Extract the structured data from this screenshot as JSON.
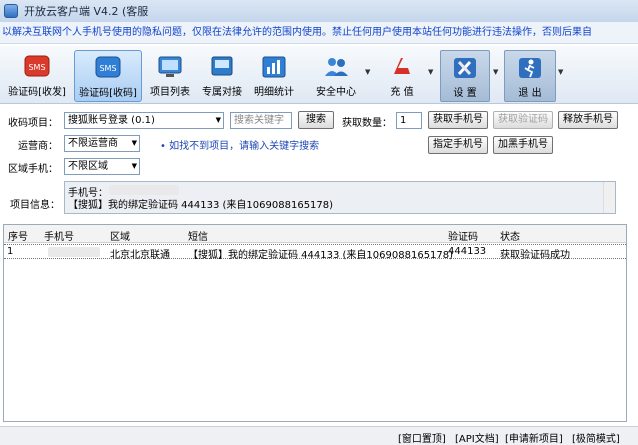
{
  "app": {
    "title": "开放云客户端 V4.2 (客服"
  },
  "notice": "以解决互联网个人手机号使用的隐私问题，仅限在法律允许的范围内使用。禁止任何用户使用本站任何功能进行违法操作，否则后果自",
  "toolbar": [
    {
      "label": "验证码[收发]",
      "icon": "sms-red-icon",
      "active": false
    },
    {
      "label": "验证码[收码]",
      "icon": "sms-blue-icon",
      "active": true
    },
    {
      "label": "项目列表",
      "icon": "project-list-icon",
      "active": false
    },
    {
      "label": "专属对接",
      "icon": "dedicated-icon",
      "active": false
    },
    {
      "label": "明细统计",
      "icon": "stats-chart-icon",
      "active": false
    },
    {
      "label": "安全中心",
      "icon": "security-users-icon",
      "active": false
    },
    {
      "label": "充 值",
      "icon": "recharge-pdf-icon",
      "active": false
    },
    {
      "label": "设 置",
      "icon": "settings-tools-icon",
      "active": false
    },
    {
      "label": "退 出",
      "icon": "exit-icon",
      "active": false
    }
  ],
  "form": {
    "project_label": "收码项目：",
    "project_value": "搜狐账号登录 (0.1)",
    "search_placeholder": "搜索关键字",
    "search_button": "搜索",
    "quantity_label": "获取数量：",
    "quantity_value": "1",
    "get_phone_button": "获取手机号",
    "get_code_button": "获取验证码",
    "release_button": "释放手机号",
    "operator_label": "运营商：",
    "operator_value": "不限运营商",
    "hint_link": "• 如找不到项目，请输入关键字搜索",
    "assign_button": "指定手机号",
    "blacklist_button": "加黑手机号",
    "region_label": "区域手机：",
    "region_value": "不限区域",
    "info_label": "项目信息：",
    "info_phone_label": "手机号：",
    "info_message": "【搜狐】我的绑定验证码 444133 (来自1069088165178)"
  },
  "table": {
    "headers": [
      "序号",
      "手机号",
      "区域",
      "短信",
      "验证码",
      "状态"
    ],
    "rows": [
      {
        "index": "1",
        "phone": "",
        "region": "北京北京联通",
        "sms": "【搜狐】我的绑定验证码 444133 (来自1069088165178)",
        "code": "444133",
        "status": "获取验证码成功"
      }
    ]
  },
  "status_bar": [
    "[窗口置顶]",
    "[API文档]",
    "[申请新项目]",
    "[极简模式]"
  ]
}
